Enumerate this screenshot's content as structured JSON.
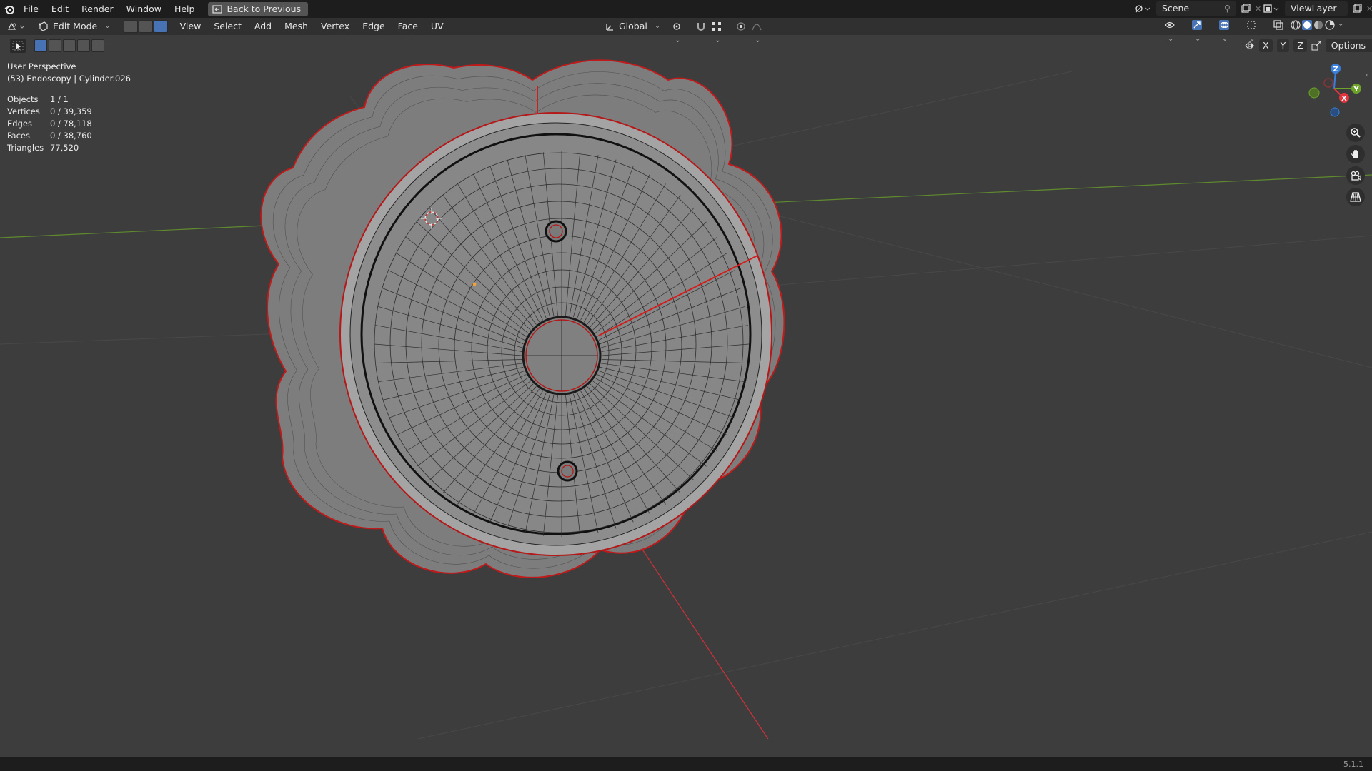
{
  "menu": {
    "file": "File",
    "edit": "Edit",
    "render": "Render",
    "window": "Window",
    "help": "Help",
    "back": "Back to Previous"
  },
  "topright": {
    "scene": "Scene",
    "viewlayer": "ViewLayer"
  },
  "header": {
    "mode": "Edit Mode",
    "items": {
      "view": "View",
      "select": "Select",
      "add": "Add",
      "mesh": "Mesh",
      "vertex": "Vertex",
      "edge": "Edge",
      "face": "Face",
      "uv": "UV"
    },
    "orientation": "Global",
    "options": "Options",
    "axis_x": "X",
    "axis_y": "Y",
    "axis_z": "Z"
  },
  "viewport": {
    "perspective": "User Perspective",
    "object": "(53) Endoscopy | Cylinder.026",
    "stats": [
      {
        "label": "Objects",
        "value": "1 / 1"
      },
      {
        "label": "Vertices",
        "value": "0 / 39,359"
      },
      {
        "label": "Edges",
        "value": "0 / 78,118"
      },
      {
        "label": "Faces",
        "value": "0 / 38,760"
      },
      {
        "label": "Triangles",
        "value": "77,520"
      }
    ]
  },
  "gizmo": {
    "x": "X",
    "y": "Y",
    "z": "Z"
  },
  "version": "5.1.1",
  "colors": {
    "accent": "#4772b3",
    "xaxis": "#e0353c",
    "yaxis": "#6ea32b",
    "zaxis": "#3b7fdc"
  }
}
